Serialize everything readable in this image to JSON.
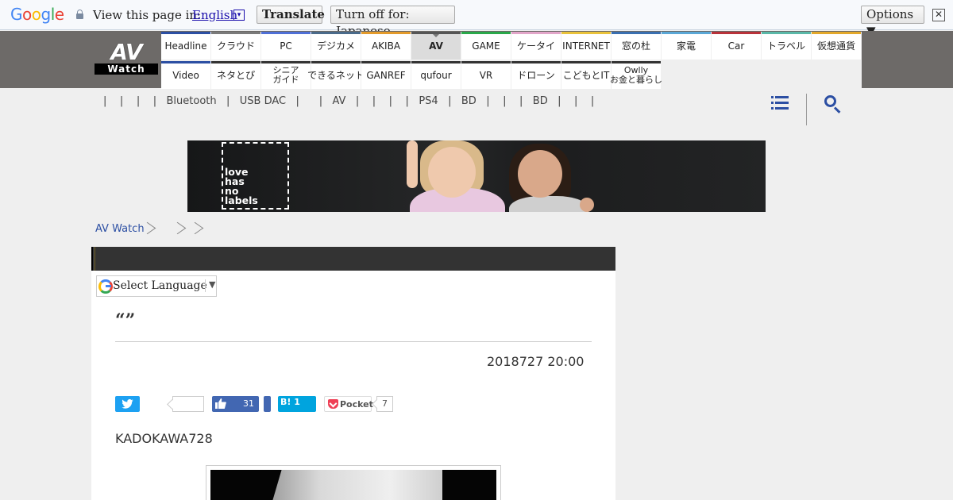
{
  "translate_bar": {
    "logo": {
      "G": "G",
      "o1": "o",
      "o2": "o",
      "g": "g",
      "l": "l",
      "e": "e"
    },
    "prompt": "View this page in:",
    "language": "English",
    "dropdown_glyph": "▾",
    "translate_label": "Translate",
    "turn_off_label": "Turn off for: Japanese",
    "options_label": "Options ▼",
    "close_glyph": "✕"
  },
  "site": {
    "logo_main": "AV",
    "logo_sub": "Watch"
  },
  "nav": {
    "row1": [
      {
        "label": "Headline",
        "color": "#2c4fa3"
      },
      {
        "label": "クラウド",
        "color": "#7a7a7a"
      },
      {
        "label": "PC",
        "color": "#4f6fd6"
      },
      {
        "label": "デジカメ",
        "color": "#4a6a8a"
      },
      {
        "label": "AKIBA",
        "color": "#e39a2a"
      },
      {
        "label": "AV",
        "color": "#555555",
        "selected": true
      },
      {
        "label": "GAME",
        "color": "#2aa84a"
      },
      {
        "label": "ケータイ",
        "color": "#e2a5c9"
      },
      {
        "label": "INTERNET",
        "color": "#e9c23a"
      },
      {
        "label": "窓の杜",
        "color": "#3a6fb0"
      },
      {
        "label": "家電",
        "color": "#5aa7d6"
      },
      {
        "label": "Car",
        "color": "#b8323a"
      },
      {
        "label": "トラベル",
        "color": "#5ab8a8"
      },
      {
        "label": "仮想通貨",
        "color": "#e3a82a"
      }
    ],
    "row2": [
      {
        "label": "Video",
        "color": "#2c4fa3"
      },
      {
        "label": "ネタとぴ",
        "color": "#333333"
      },
      {
        "label": "シニア\nガイド",
        "color": "#333333"
      },
      {
        "label": "できるネット",
        "color": "#333333"
      },
      {
        "label": "GANREF",
        "color": "#333333"
      },
      {
        "label": "qufour",
        "color": "#333333"
      },
      {
        "label": "VR",
        "color": "#333333"
      },
      {
        "label": "ドローン",
        "color": "#333333"
      },
      {
        "label": "こどもとIT",
        "color": "#333333"
      },
      {
        "label": "Owlly\nお金と暮らし",
        "color": "#333333"
      }
    ]
  },
  "sub_links": "|    |    |    |   Bluetooth   |   USB DAC   |      |   AV   |    |    |    |   PS4   |   BD   |    |    |   BD   |    |    |",
  "icons": {
    "menu": "menu-icon",
    "search": "search-icon"
  },
  "banner": {
    "text": "love\nhas\nno\nlabels"
  },
  "breadcrumb": {
    "home": "AV Watch"
  },
  "article": {
    "language_select": "Select Language",
    "language_arrow": "▼",
    "title": "“”",
    "date": "2018727 20:00",
    "share": {
      "facebook_count": "31",
      "hatena_label": "B! 1",
      "pocket_label": "Pocket",
      "pocket_count": "7"
    },
    "lead": "KADOKAWA728"
  }
}
